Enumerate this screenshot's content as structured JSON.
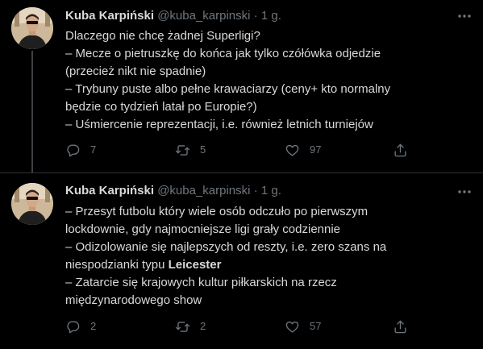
{
  "tweets": [
    {
      "author": {
        "name": "Kuba Karpiński",
        "handle": "@kuba_karpinski",
        "separator": "·",
        "time": "1 g."
      },
      "lines": [
        "Dlaczego nie chcę żadnej Superligi?",
        "– Mecze o pietruszkę do końca jak tylko czółówka odjedzie",
        "(przecież nikt nie spadnie)",
        "– Trybuny puste albo pełne krawaciarzy (ceny+ kto normalny",
        "będzie co tydzień latał po Europie?)",
        "– Uśmiercenie reprezentacji, i.e. również letnich turniejów"
      ],
      "stats": {
        "replies": "7",
        "retweets": "5",
        "likes": "97"
      }
    },
    {
      "author": {
        "name": "Kuba Karpiński",
        "handle": "@kuba_karpinski",
        "separator": "·",
        "time": "1 g."
      },
      "lines": [
        "– Przesyt futbolu który wiele osób odczuło po pierwszym",
        "lockdownie, gdy najmocniejsze ligi grały codziennie",
        "– Odizolowanie się najlepszych od reszty, i.e. zero szans na"
      ],
      "line4_prefix": "niespodzianki typu ",
      "line4_bold": "Leicester",
      "lines_after": [
        "– Zatarcie się krajowych kultur piłkarskich na rzecz",
        "międzynarodowego show"
      ],
      "stats": {
        "replies": "2",
        "retweets": "2",
        "likes": "57"
      }
    }
  ],
  "icons": {
    "more": "more-icon",
    "reply": "reply-icon",
    "retweet": "retweet-icon",
    "like": "like-icon",
    "share": "share-icon"
  },
  "colors": {
    "background": "#000000",
    "text": "#d9d9d9",
    "muted": "#6e767d",
    "divider": "#2f3336"
  }
}
